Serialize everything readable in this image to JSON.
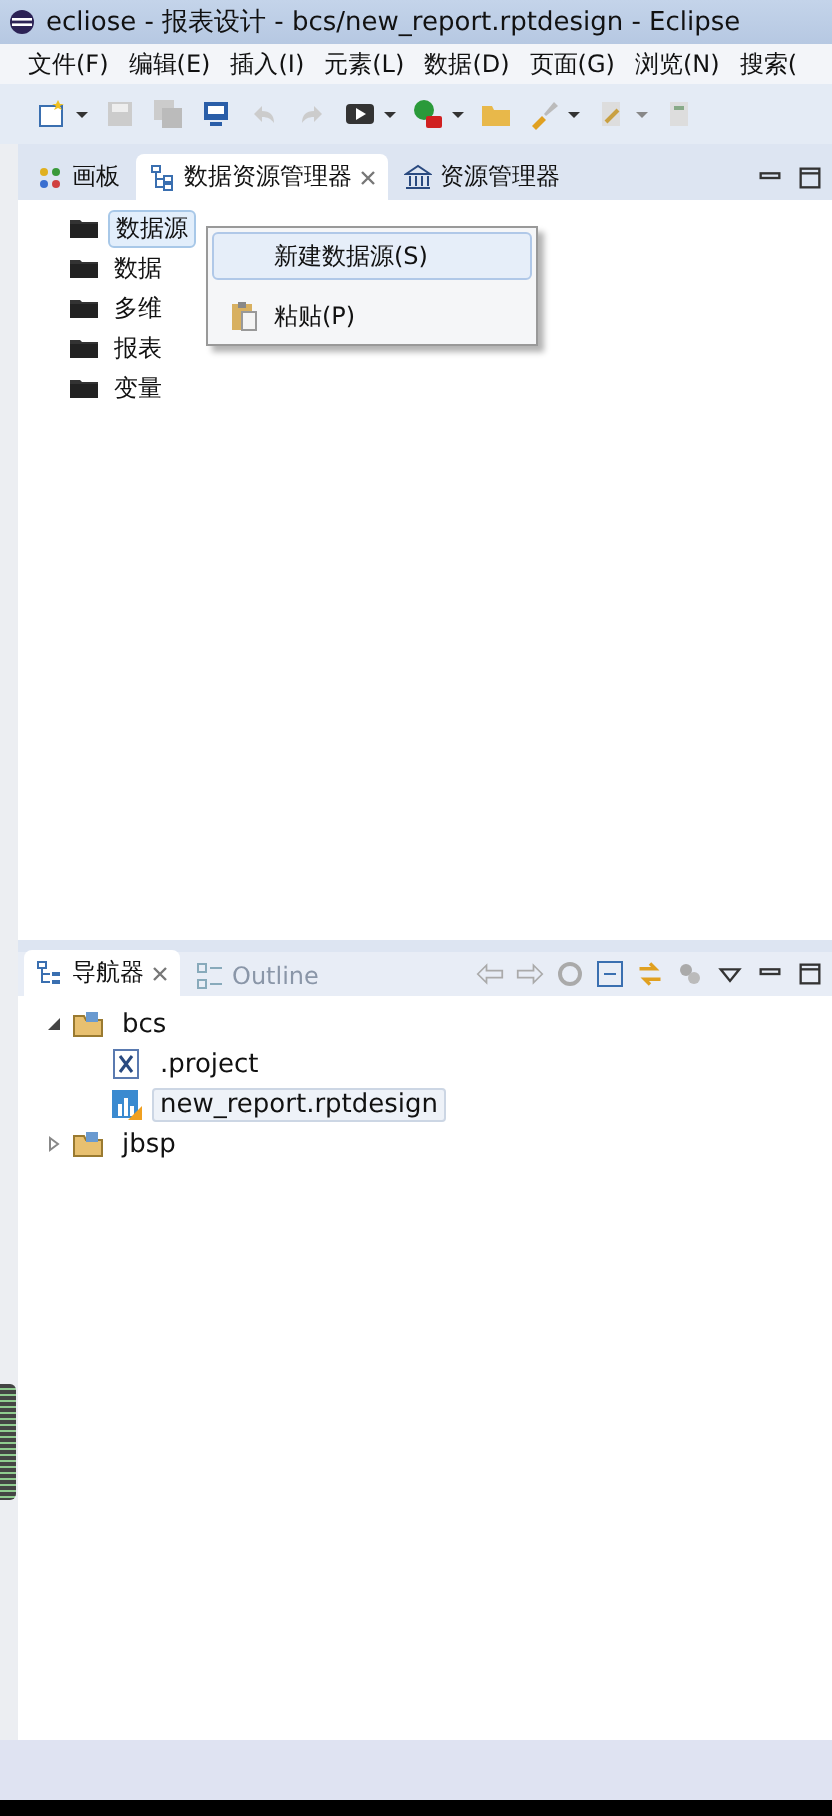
{
  "window": {
    "title": "ecliose  -  报表设计  -  bcs/new_report.rptdesign  -  Eclipse"
  },
  "menu": [
    "文件(F)",
    "编辑(E)",
    "插入(I)",
    "元素(L)",
    "数据(D)",
    "页面(G)",
    "浏览(N)",
    "搜索("
  ],
  "top_tabs": [
    {
      "label": "画板",
      "selected": false,
      "closable": false
    },
    {
      "label": "数据资源管理器",
      "selected": true,
      "closable": true
    },
    {
      "label": "资源管理器",
      "selected": false,
      "closable": false
    }
  ],
  "data_tree": [
    {
      "label": "数据源",
      "selected": true
    },
    {
      "label": "数据",
      "selected": false
    },
    {
      "label": "多维",
      "selected": false
    },
    {
      "label": "报表",
      "selected": false
    },
    {
      "label": "变量",
      "selected": false
    }
  ],
  "context_menu": [
    {
      "label": "新建数据源(S)",
      "selected": true,
      "kind": "plain"
    },
    {
      "label": "粘贴(P)",
      "selected": false,
      "kind": "paste"
    }
  ],
  "bottom_tabs": [
    {
      "label": "导航器",
      "selected": true,
      "closable": true
    },
    {
      "label": "Outline",
      "selected": false,
      "closable": false
    }
  ],
  "navigator": [
    {
      "label": "bcs",
      "kind": "project",
      "expanded": true,
      "selected": false,
      "children": [
        {
          "label": ".project",
          "kind": "xml",
          "selected": false
        },
        {
          "label": "new_report.rptdesign",
          "kind": "report",
          "selected": true
        }
      ]
    },
    {
      "label": "jbsp",
      "kind": "project",
      "expanded": false,
      "selected": false
    }
  ]
}
